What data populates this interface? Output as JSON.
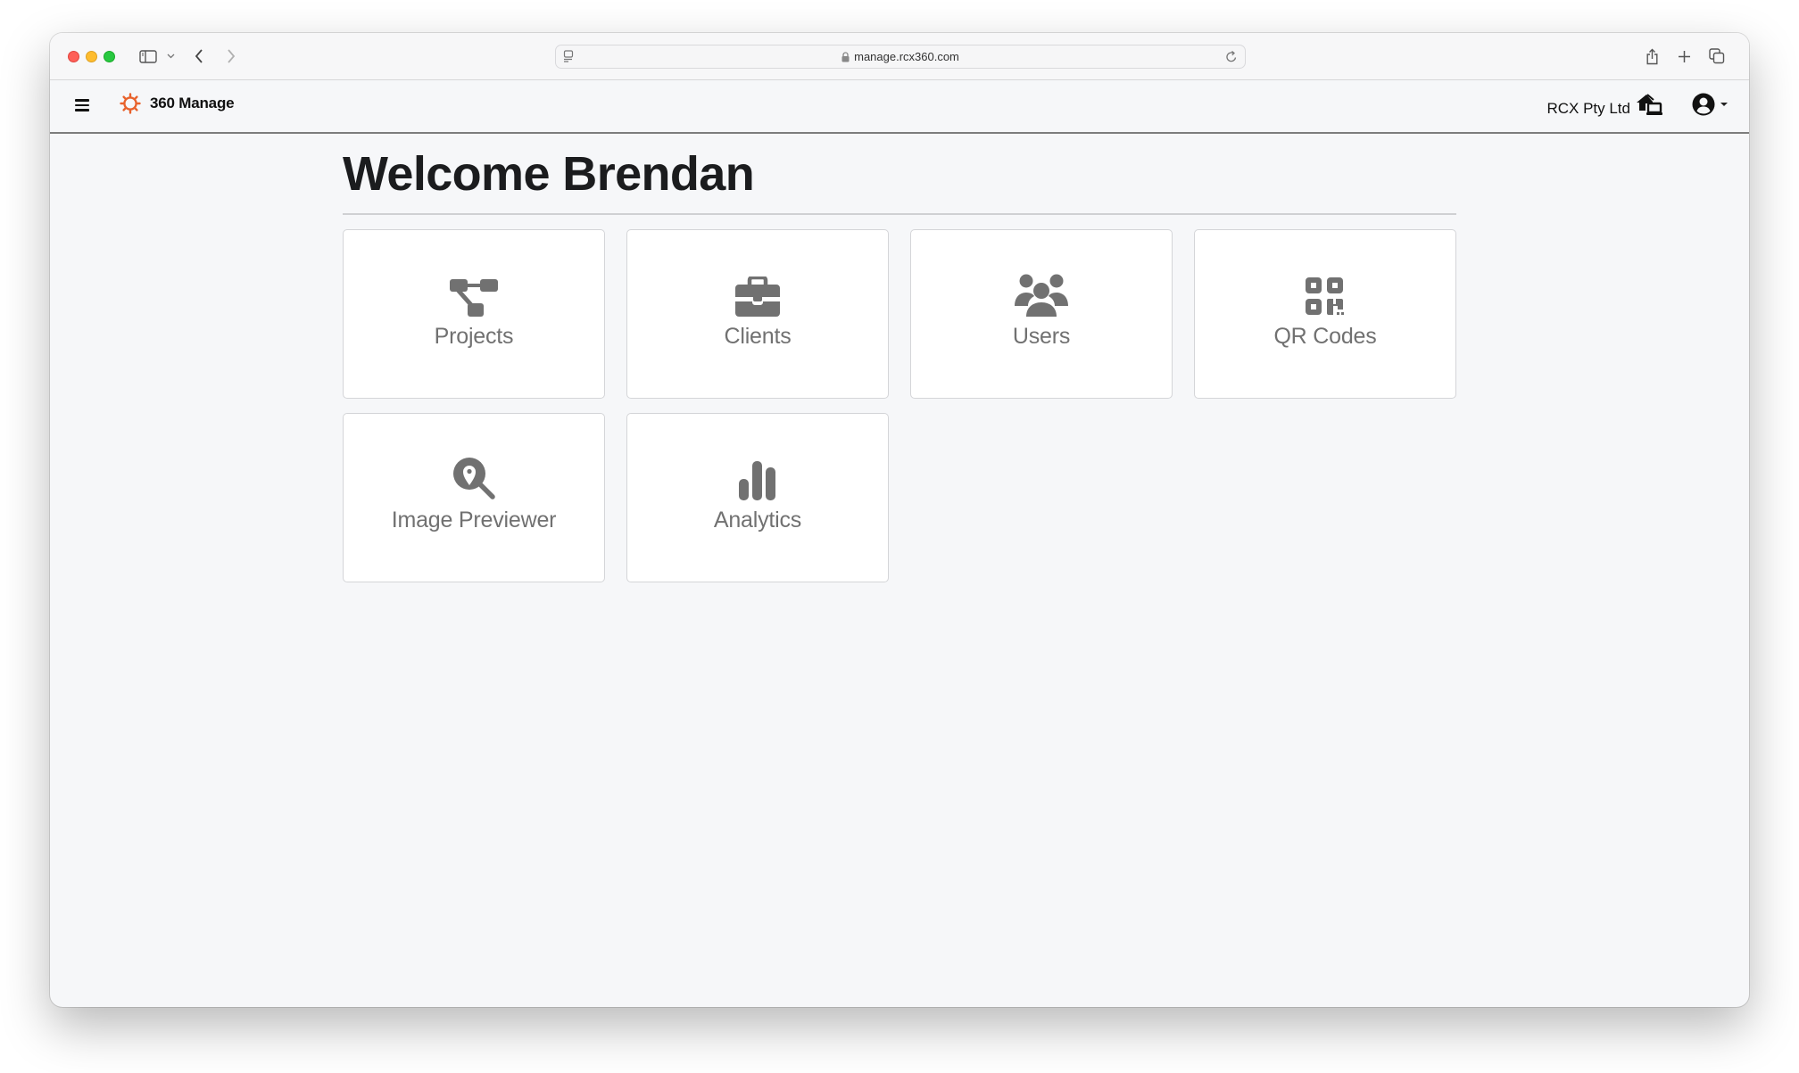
{
  "browser": {
    "url": "manage.rcx360.com",
    "icons": {
      "sidebar": "sidebar-icon",
      "sidebar_dropdown": "chevron-down-icon",
      "back": "chevron-left-icon",
      "forward": "chevron-right-icon",
      "page_settings": "page-menu-icon",
      "lock": "lock-icon",
      "reload": "reload-icon",
      "share": "share-icon",
      "new_tab": "plus-icon",
      "tabs_overview": "tabs-icon"
    }
  },
  "navbar": {
    "brand_name": "360 Manage",
    "brand_color": "#e8622c",
    "organization": "RCX Pty Ltd",
    "icons": {
      "menu": "hamburger-icon",
      "logo": "sun-gear-icon",
      "organization": "laptop-house-icon",
      "user": "user-circle-icon",
      "user_dropdown": "caret-down-icon"
    }
  },
  "main": {
    "title": "Welcome Brendan",
    "icon_color": "#717171",
    "tiles": [
      {
        "label": "Projects",
        "icon": "project-diagram-icon"
      },
      {
        "label": "Clients",
        "icon": "briefcase-icon"
      },
      {
        "label": "Users",
        "icon": "users-icon"
      },
      {
        "label": "QR Codes",
        "icon": "qrcode-icon"
      },
      {
        "label": "Image Previewer",
        "icon": "search-location-icon"
      },
      {
        "label": "Analytics",
        "icon": "chart-bars-icon"
      }
    ]
  }
}
